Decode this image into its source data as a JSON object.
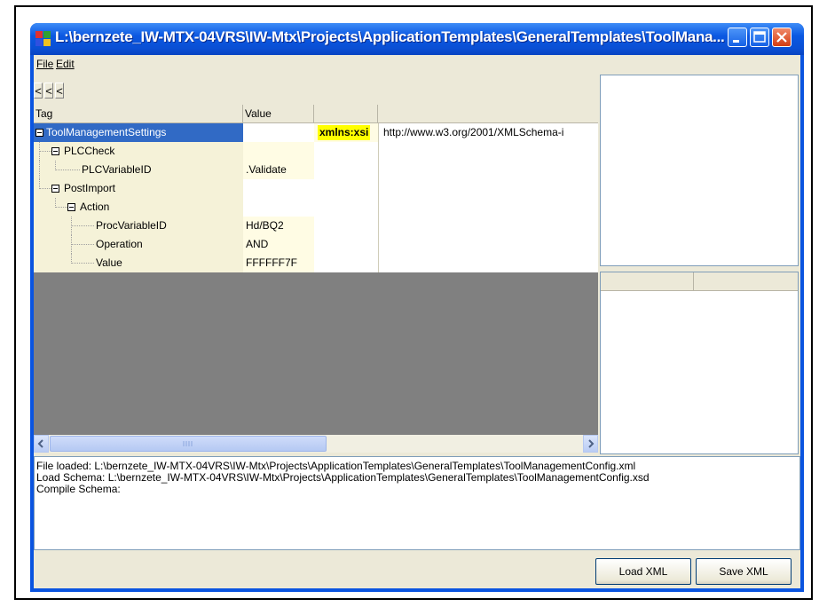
{
  "window": {
    "title": "L:\\bernzete_IW-MTX-04VRS\\IW-Mtx\\Projects\\ApplicationTemplates\\GeneralTemplates\\ToolMana..."
  },
  "menu": {
    "items": [
      {
        "label": "File"
      },
      {
        "label": "Edit"
      }
    ]
  },
  "nav": {
    "buttons": [
      "<",
      "<",
      "<"
    ]
  },
  "grid": {
    "columns": [
      "Tag",
      "Value"
    ],
    "rows": [
      {
        "tag": "ToolManagementSettings",
        "value": "",
        "attr_name": "xmlns:xsi",
        "attr_value": "http://www.w3.org/2001/XMLSchema-i",
        "selected": true,
        "level": 0,
        "expanded": true
      },
      {
        "tag": "PLCCheck",
        "value": "",
        "level": 1,
        "expanded": true
      },
      {
        "tag": "PLCVariableID",
        "value": ".Validate",
        "level": 2
      },
      {
        "tag": "PostImport",
        "value": "",
        "level": 1,
        "expanded": true
      },
      {
        "tag": "Action",
        "value": "",
        "level": 2,
        "expanded": true
      },
      {
        "tag": "ProcVariableID",
        "value": "Hd/BQ2",
        "level": 3
      },
      {
        "tag": "Operation",
        "value": "AND",
        "level": 3
      },
      {
        "tag": "Value",
        "value": "FFFFFF7F",
        "level": 3
      }
    ]
  },
  "log": {
    "lines": [
      "File loaded: L:\\bernzete_IW-MTX-04VRS\\IW-Mtx\\Projects\\ApplicationTemplates\\GeneralTemplates\\ToolManagementConfig.xml",
      "Load Schema: L:\\bernzete_IW-MTX-04VRS\\IW-Mtx\\Projects\\ApplicationTemplates\\GeneralTemplates\\ToolManagementConfig.xsd",
      "Compile Schema:"
    ]
  },
  "buttons": {
    "load": "Load XML",
    "save": "Save XML"
  },
  "colors": {
    "titlebar": "#0a54e0",
    "selection": "#316ac5",
    "attr_highlight": "#ffff00",
    "grid_background": "#808080"
  }
}
